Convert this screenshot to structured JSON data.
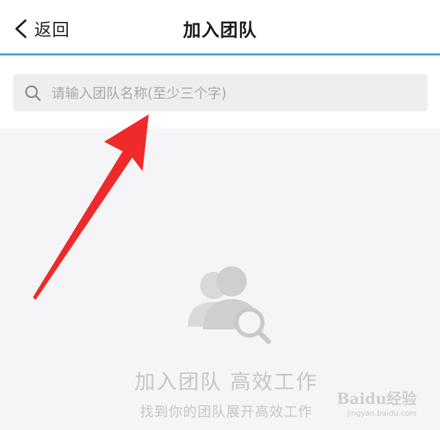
{
  "header": {
    "back_label": "返回",
    "title": "加入团队"
  },
  "search": {
    "placeholder": "请输入团队名称(至少三个字)",
    "icon": "search-icon"
  },
  "empty_state": {
    "icon": "team-search-icon",
    "title": "加入团队 高效工作",
    "subtitle": "找到你的团队展开高效工作"
  },
  "annotation": {
    "arrow_color": "#f02a2a"
  },
  "watermark": {
    "logo": "Baidu经验",
    "url": "jingyan.baidu.com"
  },
  "colors": {
    "header_border": "#4b9fd8",
    "background": "#f5f4f6",
    "search_fill": "#eeedef"
  }
}
